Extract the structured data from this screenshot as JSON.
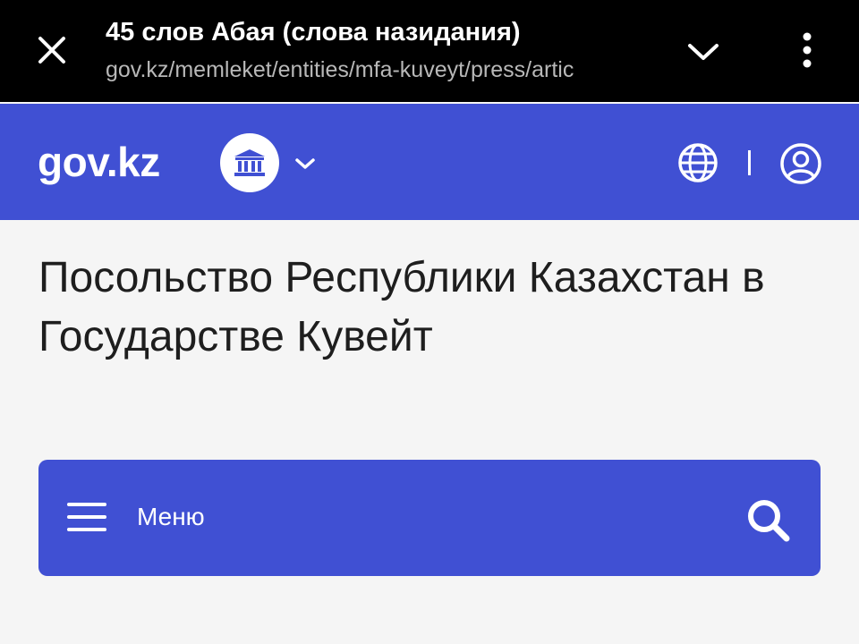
{
  "browser": {
    "title": "45 слов Абая (слова назидания)",
    "url": "gov.kz/memleket/entities/mfa-kuveyt/press/artic",
    "icons": {
      "close": "close-icon",
      "collapse": "chevron-down-icon",
      "more": "more-vertical-icon"
    }
  },
  "header": {
    "logo": "gov.kz",
    "icons": {
      "entity": "government-building-icon",
      "entity_dropdown": "chevron-down-icon",
      "language": "globe-icon",
      "profile": "user-circle-icon"
    }
  },
  "main": {
    "org_title": "Посольство Республики Казахстан в Государстве Кувейт",
    "menu": {
      "label": "Меню",
      "icons": {
        "menu": "hamburger-icon",
        "search": "search-icon"
      }
    }
  },
  "colors": {
    "brand_blue": "#4050d3",
    "browser_bar": "#000000",
    "page_background": "#f5f5f5"
  }
}
